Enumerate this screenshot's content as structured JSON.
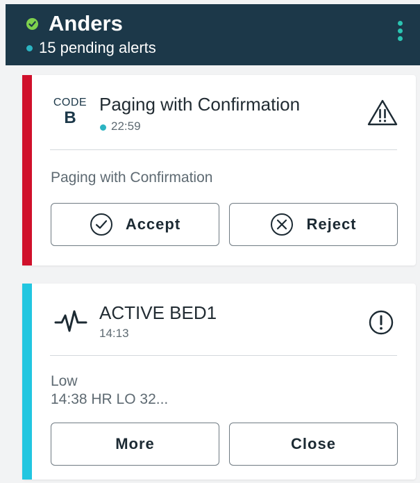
{
  "header": {
    "user_name": "Anders",
    "pending_alerts": "15 pending alerts",
    "status_color": "#7ed14d",
    "background": "#1c3849"
  },
  "alerts": [
    {
      "accent_color": "#d0102b",
      "code_prefix": "CODE",
      "code_letter": "B",
      "title": "Paging with Confirmation",
      "time": "22:59",
      "icon": "warning-triangle-icon",
      "body": "Paging with Confirmation",
      "buttons": [
        {
          "label": "Accept",
          "icon": "check-circle-icon"
        },
        {
          "label": "Reject",
          "icon": "x-circle-icon"
        }
      ]
    },
    {
      "accent_color": "#22c6e0",
      "icon_left": "heartbeat-icon",
      "title": "ACTIVE BED1",
      "time": "14:13",
      "icon": "exclamation-circle-icon",
      "body_line1": "Low",
      "body_line2": "14:38 HR LO 32...",
      "buttons": [
        {
          "label": "More"
        },
        {
          "label": "Close"
        }
      ]
    }
  ]
}
